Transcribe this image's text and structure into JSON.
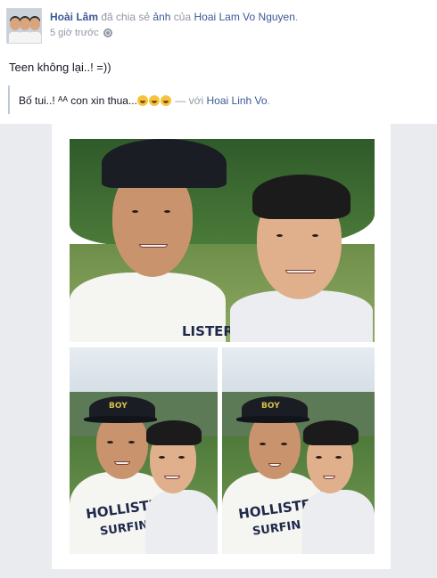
{
  "post": {
    "author_name": "Hoài Lâm",
    "action_text": "đã chia sẻ",
    "object_link": "ảnh",
    "possessive_text": "của",
    "source_name": "Hoai Lam Vo Nguyen",
    "period": ".",
    "timestamp": "5 giờ trước",
    "privacy_icon": "globe-icon",
    "status_text": "Teen không lại..! =))"
  },
  "shared": {
    "caption_text": "Bố tui..! ᴬᴬ con xin thua...",
    "emoji_count": 3,
    "with_text": "— với",
    "tagged_name": "Hoai Linh Vo",
    "period": "."
  },
  "photos": {
    "big": {
      "shirt_text": "LISTER"
    },
    "small1": {
      "hat_text": "BOY",
      "shirt_text_line1": "HOLLISTER",
      "shirt_text_line2": "SURFIN"
    },
    "small2": {
      "hat_text": "BOY",
      "shirt_text_line1": "HOLLISTER",
      "shirt_text_line2": "SURFIN"
    }
  },
  "colors": {
    "link": "#3b5998",
    "muted": "#9197a3",
    "text": "#141823",
    "background_gray": "#e9ebee"
  }
}
